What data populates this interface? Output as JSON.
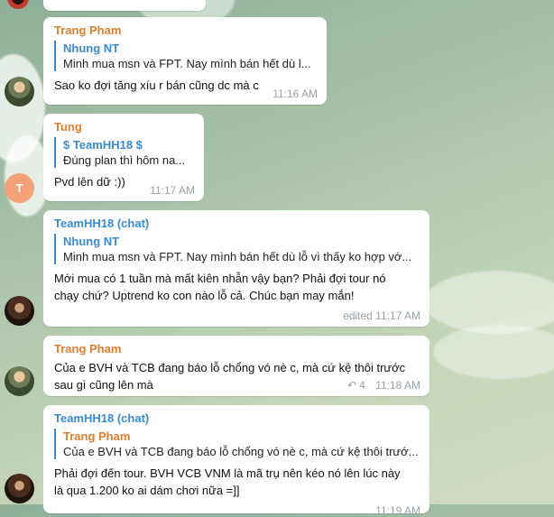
{
  "colors": {
    "sender_orange": "#e07d2b",
    "sender_blue": "#3a8bd3",
    "reply_accent": "#3a8bd3",
    "avatar_letter_bg": "#f5a17a"
  },
  "messages": [
    {
      "sender": "Trang Pham",
      "reply_name": "Nhung NT",
      "reply_text": "Minh mua msn và FPT. Nay mình bán hết dù l...",
      "text": "Sao ko đợi tăng xíu r bán cũng dc mà c",
      "time": "11:16 AM"
    },
    {
      "sender": "Tung",
      "reply_name": "$ TeamHH18 $",
      "reply_text": "Đúng plan thì hôm na...",
      "text": "Pvd lên dữ :))",
      "time": "11:17 AM",
      "avatar_letter": "T"
    },
    {
      "sender": "TeamHH18 (chat)",
      "reply_name": "Nhung NT",
      "reply_text": "Minh mua msn và FPT. Nay mình bán hết dù lỗ vì thấy ko hợp vớ...",
      "text": "Mới mua có 1 tuần mà mất kiên nhẫn vậy bạn? Phải đợi tour nó chạy chứ? Uptrend ko con nào lỗ cả. Chúc bạn may mắn!",
      "time": "edited 11:17 AM"
    },
    {
      "sender": "Trang Pham",
      "text": "Của e BVH và TCB  đang báo lỗ chổng vó nè c, mà cứ kệ thôi trước sau gì cũng lên mà",
      "reply_count": "4",
      "time": "11:18 AM"
    },
    {
      "sender": "TeamHH18 (chat)",
      "reply_name": "Trang Pham",
      "reply_text": "Của e BVH và TCB  đang báo lỗ chổng vó nè c, mà cứ kệ thôi trướ...",
      "text": "Phải đợi đến tour. BVH VCB VNM là mã trụ nên kéo nó lên lúc này là qua 1.200 ko ai dám chơi nữa =]]",
      "time": "11:19 AM"
    }
  ]
}
